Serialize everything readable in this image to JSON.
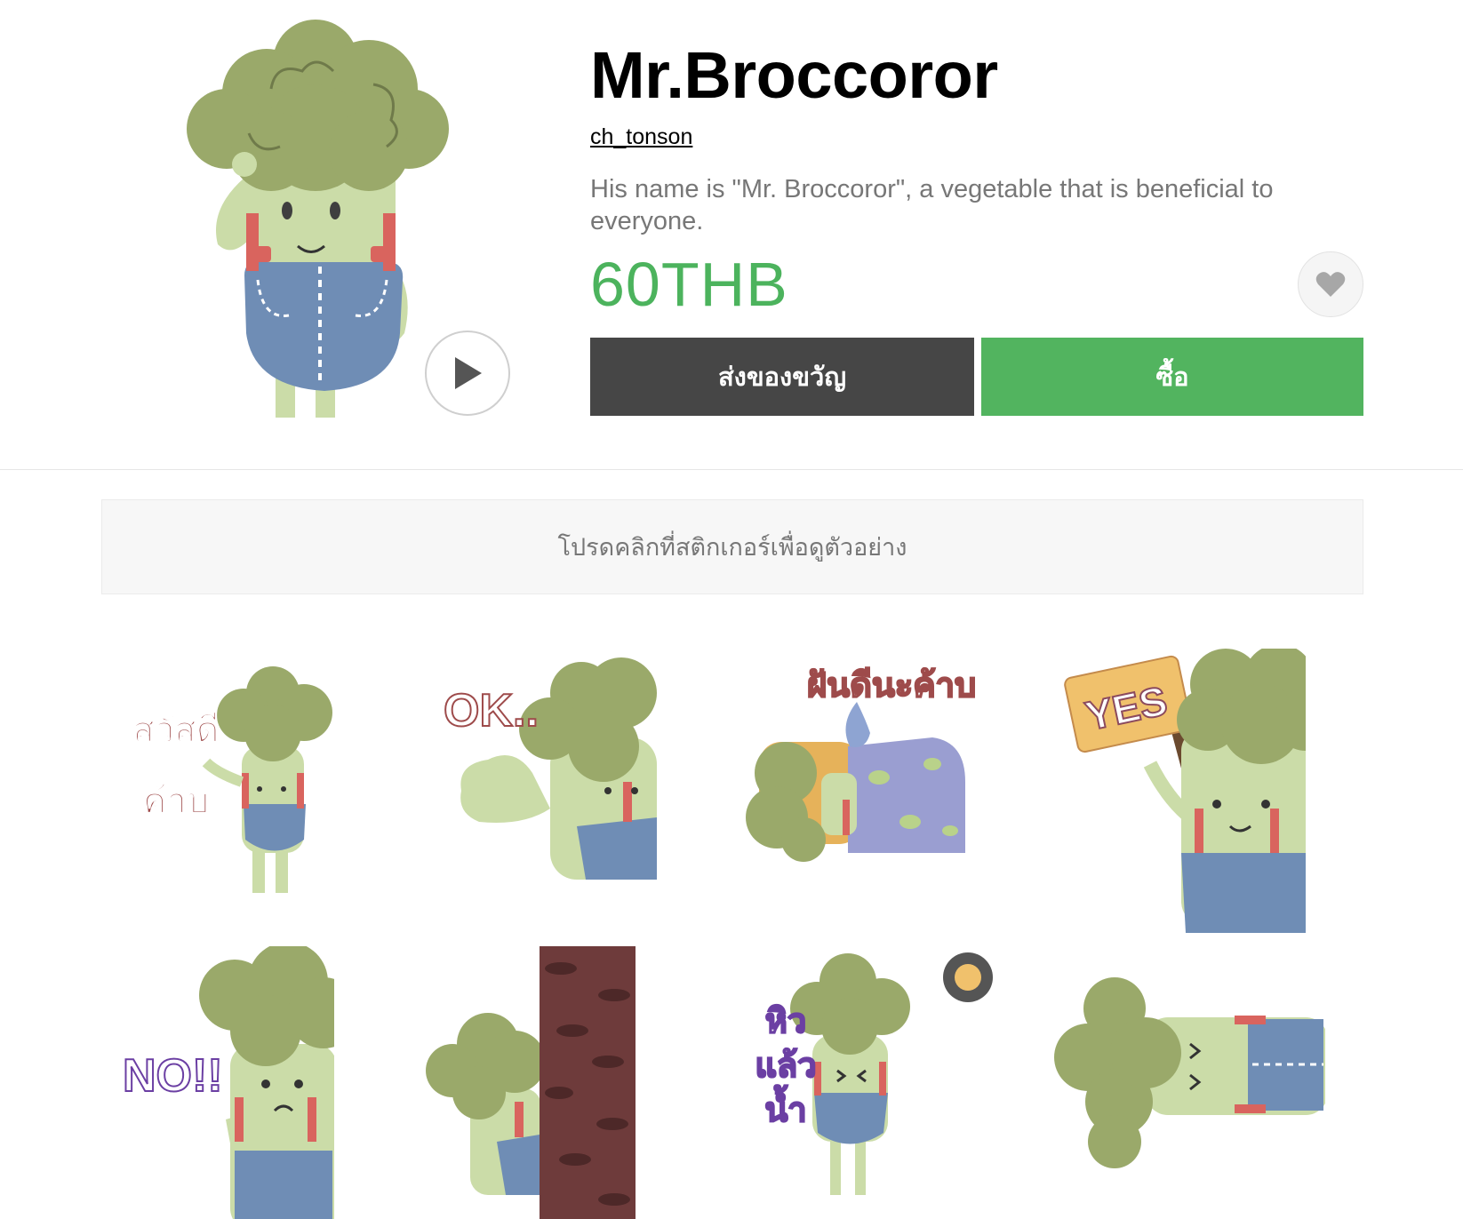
{
  "product": {
    "title": "Mr.Broccoror",
    "author": "ch_tonson",
    "description": "His name is \"Mr. Broccoror\", a vegetable that is beneficial to everyone.",
    "price": "60THB"
  },
  "buttons": {
    "gift_label": "ส่งของขวัญ",
    "buy_label": "ซื้อ",
    "play_icon": "play-icon",
    "favorite_icon": "heart-icon"
  },
  "preview_hint": "โปรดคลิกที่สติกเกอร์เพื่อดูตัวอย่าง",
  "stickers": [
    {
      "text": "สวัสดี ค้าบ"
    },
    {
      "text": "OK.."
    },
    {
      "text": "ฝันดีนะค้าบ"
    },
    {
      "text": "YES"
    },
    {
      "text": "NO!!"
    },
    {
      "text": ""
    },
    {
      "text": "หิว แล้ว น้ำ"
    },
    {
      "text": ""
    }
  ],
  "colors": {
    "price": "#4cb35d",
    "buy_button": "#52b45f",
    "gift_button": "#464646",
    "broccoli_head": "#9aa96a",
    "body": "#cbdca8",
    "overalls": "#6f8db5",
    "suspenders": "#d9645e"
  }
}
